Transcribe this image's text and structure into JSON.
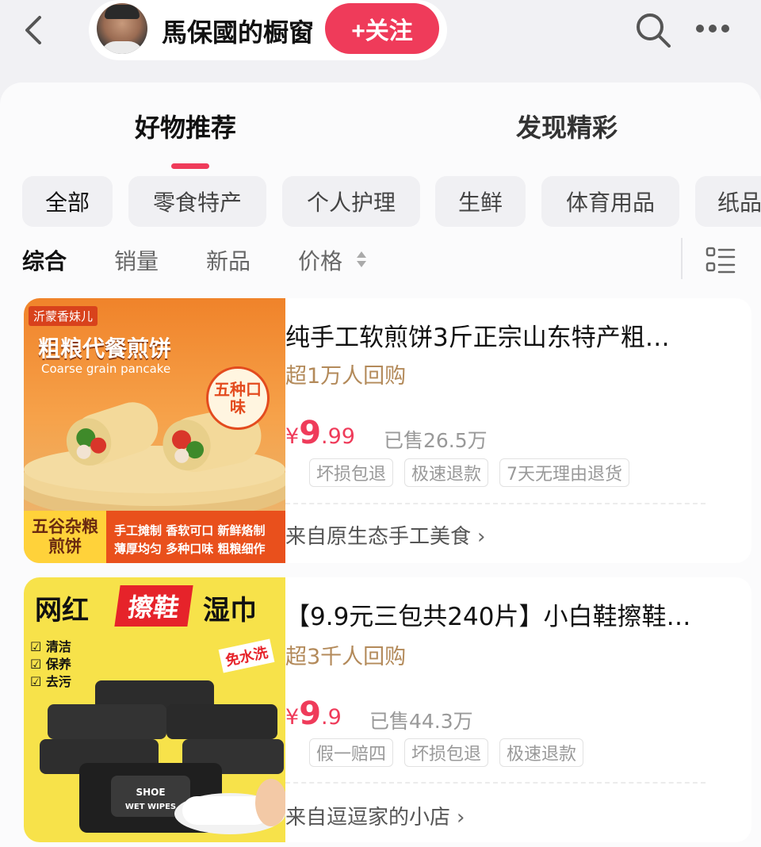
{
  "header": {
    "shop_name": "馬保國的橱窗",
    "follow_label": "+关注"
  },
  "tabs": [
    {
      "label": "好物推荐",
      "active": true
    },
    {
      "label": "发现精彩",
      "active": false
    }
  ],
  "categories": [
    "全部",
    "零食特产",
    "个人护理",
    "生鲜",
    "体育用品",
    "纸品"
  ],
  "sort": {
    "options": [
      "综合",
      "销量",
      "新品",
      "价格"
    ],
    "active": "综合"
  },
  "accent_color": "#ef3b5a",
  "products": [
    {
      "title": "纯手工软煎饼3斤正宗山东特产粗…",
      "repeat_buyers": "超1万人回购",
      "price_symbol": "¥",
      "price_int": "9",
      "price_dec": ".99",
      "sold": "已售26.5万",
      "badges": [
        "坏损包退",
        "极速退款",
        "7天无理由退货"
      ],
      "shop": "来自原生态手工美食",
      "image_text": {
        "brand": "沂蒙香妹儿",
        "headline": "粗粮代餐煎饼",
        "subtitle": "Coarse grain pancake",
        "flavor_badge": "五种口味",
        "bottom_left": "五谷杂粮煎饼",
        "bottom_line1": "手工摊制 香软可口 新鲜烙制",
        "bottom_line2": "薄厚均匀 多种口味 粗粮细作"
      }
    },
    {
      "title": "【9.9元三包共240片】小白鞋擦鞋…",
      "repeat_buyers": "超3千人回购",
      "price_symbol": "¥",
      "price_int": "9",
      "price_dec": ".9",
      "sold": "已售44.3万",
      "badges": [
        "假一赔四",
        "坏损包退",
        "极速退款"
      ],
      "shop": "来自逗逗家的小店",
      "image_text": {
        "headline_1": "网红",
        "headline_2": "擦鞋",
        "headline_3": "湿巾",
        "bullets": [
          "清洁",
          "保养",
          "去污"
        ],
        "no_wash": "免水洗",
        "pack_label": "SHOE WET WIPES"
      }
    }
  ]
}
